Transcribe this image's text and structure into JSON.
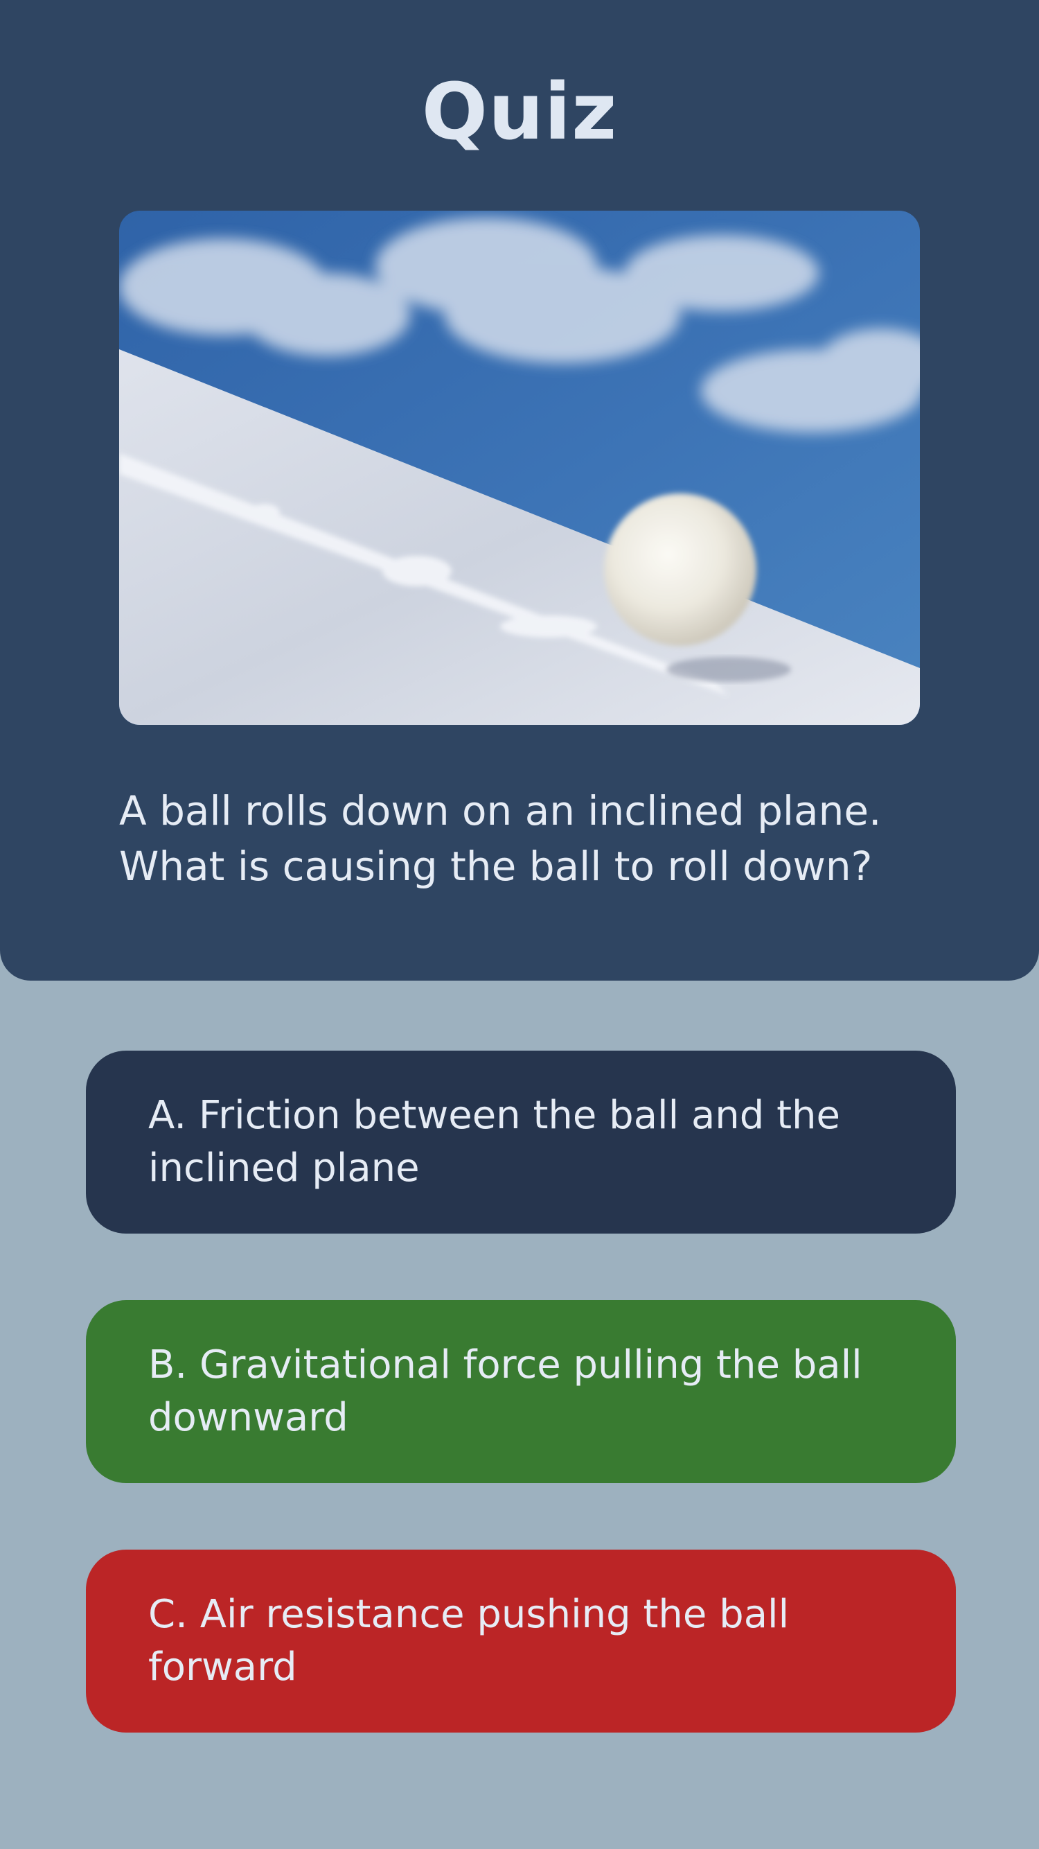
{
  "header": {
    "title": "Quiz"
  },
  "image": {
    "alt": "snowball rolling down a snowy slope",
    "icon": "snowball-photo"
  },
  "question": {
    "text": "A ball rolls down on an inclined plane. What is causing the ball to roll down?"
  },
  "options": [
    {
      "label": "A. Friction between the ball and the inclined plane",
      "color": "#26354e"
    },
    {
      "label": "B. Gravitational force pulling the ball downward",
      "color": "#397b31"
    },
    {
      "label": "C. Air resistance pushing the ball forward",
      "color": "#bb2526"
    }
  ],
  "colors": {
    "page_background": "#9db1bf",
    "header_background": "#2f4562",
    "text": "#e6ecf5"
  }
}
